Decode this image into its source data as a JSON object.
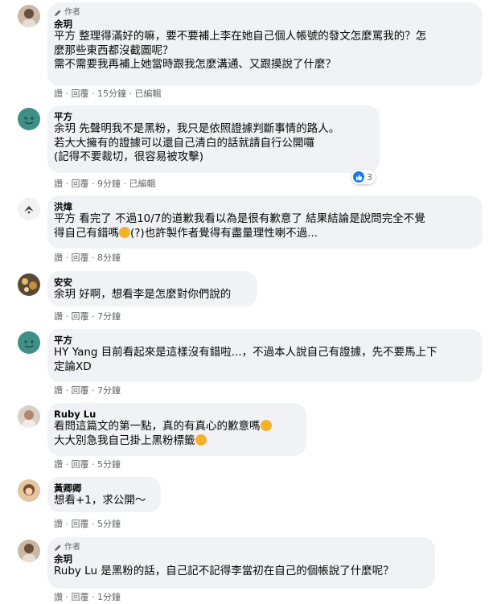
{
  "comments": [
    {
      "author_badge": "作者",
      "author": "余玥",
      "lines": [
        "平方 整理得滿好的嘛，要不要補上李在她自己個人帳號的發文怎麼罵我的？怎",
        "麼那些東西都沒截圖呢？",
        "需不需要我再補上她當時跟我怎麼溝通、又跟摸說了什麼？"
      ],
      "actions": {
        "like": "讚",
        "reply": "回覆",
        "time": "15分鐘",
        "edited": "已編輯"
      }
    },
    {
      "author": "平方",
      "lines": [
        "余玥 先聲明我不是黑粉，我只是依照證據判斷事情的路人。",
        "若大大擁有的證據可以還自己清白的話就請自行公開囉",
        "(記得不要裁切，很容易被攻擊)"
      ],
      "reaction_count": "3",
      "actions": {
        "like": "讚",
        "reply": "回覆",
        "time": "9分鐘",
        "edited": "已編輯"
      }
    },
    {
      "author": "洪煒",
      "lines": [
        "平方 看完了 不過10/7的道歉我看以為是很有歉意了 結果結論是說問完全不覺",
        "得自己有錯嗎",
        "(?)也許製作者覺得有盡量理性喇不過..."
      ],
      "actions": {
        "like": "讚",
        "reply": "回覆",
        "time": "8分鐘"
      }
    },
    {
      "author": "安安",
      "lines": [
        "余玥 好啊，想看李是怎麼對你們說的"
      ],
      "actions": {
        "like": "讚",
        "reply": "回覆",
        "time": "7分鐘"
      }
    },
    {
      "author": "平方",
      "lines": [
        "HY Yang 目前看起來是這樣沒有錯啦...，不過本人說自己有證據，先不要馬上下",
        "定論XD"
      ],
      "actions": {
        "like": "讚",
        "reply": "回覆",
        "time": "7分鐘"
      }
    },
    {
      "author": "Ruby Lu",
      "lines": [
        "看問這篇文的第一點，真的有真心的歉意嗎",
        "大大別急我自己掛上黑粉標籤"
      ],
      "actions": {
        "like": "讚",
        "reply": "回覆",
        "time": "5分鐘"
      }
    },
    {
      "author": "黃卿卿",
      "lines": [
        "想看+1，求公開～"
      ],
      "actions": {
        "like": "讚",
        "reply": "回覆",
        "time": "5分鐘"
      }
    },
    {
      "author_badge": "作者",
      "author": "余玥",
      "lines": [
        "Ruby Lu 是黑粉的話，自己記不記得李當初在自己的個帳說了什麼呢？"
      ],
      "actions": {
        "like": "讚",
        "reply": "回覆",
        "time": "1分鐘"
      }
    }
  ],
  "separator": "·"
}
